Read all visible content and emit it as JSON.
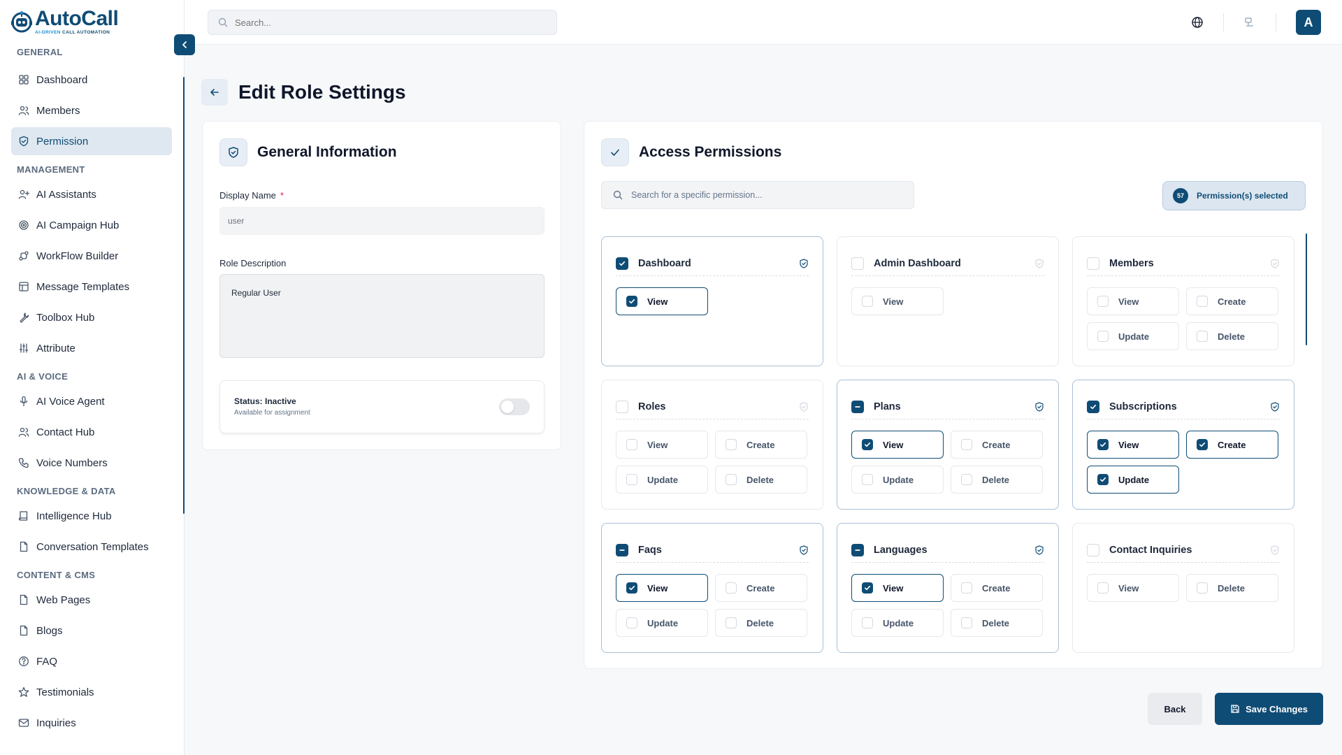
{
  "brand": {
    "name": "AutoCall",
    "tagline_accent": "AI-DRIVEN",
    "tagline_rest": " CALL AUTOMATION",
    "primary_color": "#0f4c75"
  },
  "topbar": {
    "search_placeholder": "Search...",
    "avatar_initial": "A"
  },
  "sidebar": {
    "sections": [
      {
        "title": "GENERAL",
        "items": [
          {
            "label": "Dashboard",
            "icon": "grid-icon"
          },
          {
            "label": "Members",
            "icon": "users-icon"
          },
          {
            "label": "Permission",
            "icon": "shield-check-icon",
            "active": true
          }
        ]
      },
      {
        "title": "MANAGEMENT",
        "items": [
          {
            "label": "AI Assistants",
            "icon": "user-plus-icon"
          },
          {
            "label": "AI Campaign Hub",
            "icon": "target-icon"
          },
          {
            "label": "WorkFlow Builder",
            "icon": "route-icon"
          },
          {
            "label": "Message Templates",
            "icon": "layout-icon"
          },
          {
            "label": "Toolbox Hub",
            "icon": "wrench-icon"
          },
          {
            "label": "Attribute",
            "icon": "sliders-icon"
          }
        ]
      },
      {
        "title": "AI & VOICE",
        "items": [
          {
            "label": "AI Voice Agent",
            "icon": "mic-icon"
          },
          {
            "label": "Contact Hub",
            "icon": "users-icon"
          },
          {
            "label": "Voice Numbers",
            "icon": "phone-icon"
          }
        ]
      },
      {
        "title": "KNOWLEDGE & DATA",
        "items": [
          {
            "label": "Intelligence Hub",
            "icon": "book-icon"
          },
          {
            "label": "Conversation Templates",
            "icon": "file-icon"
          }
        ]
      },
      {
        "title": "CONTENT & CMS",
        "items": [
          {
            "label": "Web Pages",
            "icon": "file-icon"
          },
          {
            "label": "Blogs",
            "icon": "file-icon"
          },
          {
            "label": "FAQ",
            "icon": "help-circle-icon"
          },
          {
            "label": "Testimonials",
            "icon": "star-icon"
          },
          {
            "label": "Inquiries",
            "icon": "mail-icon"
          }
        ]
      }
    ]
  },
  "page": {
    "title": "Edit Role Settings"
  },
  "general": {
    "title": "General Information",
    "display_name_label": "Display Name",
    "required_mark": "*",
    "display_name_value": "user",
    "description_label": "Role Description",
    "description_value": "Regular User",
    "status_title": "Status: Inactive",
    "status_sub": "Available for assignment",
    "status_active": false
  },
  "access": {
    "title": "Access Permissions",
    "search_placeholder": "Search for a specific permission...",
    "selected_count": "57",
    "selected_label": "Permission(s) selected",
    "modules": [
      {
        "name": "Dashboard",
        "state": "on",
        "options": [
          {
            "label": "View",
            "checked": true
          }
        ]
      },
      {
        "name": "Admin Dashboard",
        "state": "off",
        "options": [
          {
            "label": "View",
            "checked": false
          }
        ]
      },
      {
        "name": "Members",
        "state": "off",
        "options": [
          {
            "label": "View",
            "checked": false
          },
          {
            "label": "Create",
            "checked": false
          },
          {
            "label": "Update",
            "checked": false
          },
          {
            "label": "Delete",
            "checked": false
          }
        ]
      },
      {
        "name": "Roles",
        "state": "off",
        "options": [
          {
            "label": "View",
            "checked": false
          },
          {
            "label": "Create",
            "checked": false
          },
          {
            "label": "Update",
            "checked": false
          },
          {
            "label": "Delete",
            "checked": false
          }
        ]
      },
      {
        "name": "Plans",
        "state": "part",
        "options": [
          {
            "label": "View",
            "checked": true
          },
          {
            "label": "Create",
            "checked": false
          },
          {
            "label": "Update",
            "checked": false
          },
          {
            "label": "Delete",
            "checked": false
          }
        ]
      },
      {
        "name": "Subscriptions",
        "state": "on",
        "options": [
          {
            "label": "View",
            "checked": true
          },
          {
            "label": "Create",
            "checked": true
          },
          {
            "label": "Update",
            "checked": true
          }
        ]
      },
      {
        "name": "Faqs",
        "state": "part",
        "options": [
          {
            "label": "View",
            "checked": true
          },
          {
            "label": "Create",
            "checked": false
          },
          {
            "label": "Update",
            "checked": false
          },
          {
            "label": "Delete",
            "checked": false
          }
        ]
      },
      {
        "name": "Languages",
        "state": "part",
        "options": [
          {
            "label": "View",
            "checked": true
          },
          {
            "label": "Create",
            "checked": false
          },
          {
            "label": "Update",
            "checked": false
          },
          {
            "label": "Delete",
            "checked": false
          }
        ]
      },
      {
        "name": "Contact Inquiries",
        "state": "off",
        "options": [
          {
            "label": "View",
            "checked": false
          },
          {
            "label": "Delete",
            "checked": false
          }
        ]
      }
    ]
  },
  "footer": {
    "back_label": "Back",
    "save_label": "Save Changes"
  }
}
